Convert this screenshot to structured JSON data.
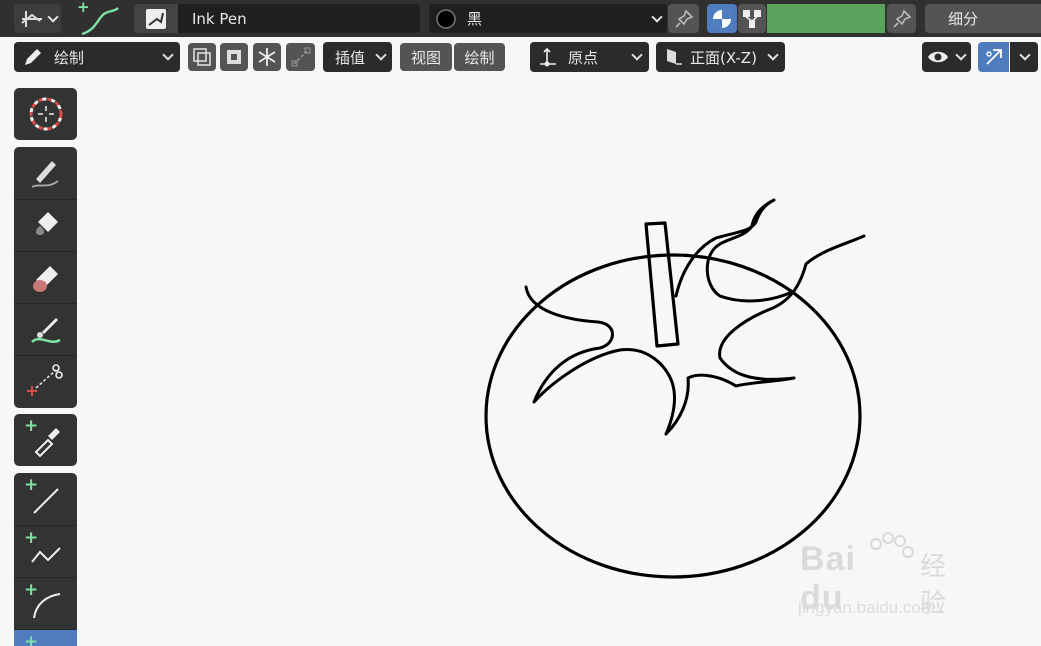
{
  "header": {
    "brush_name": "Ink Pen",
    "material_name": "黑",
    "subdivide_label": "细分",
    "vertex_color_hex": "#5aa35d"
  },
  "toolbar": {
    "mode_label": "绘制",
    "interpolate_label": "插值",
    "view_label": "视图",
    "draw_label": "绘制",
    "origin_label": "原点",
    "axis_label": "正面(X-Z)"
  },
  "tools": [
    {
      "name": "cursor-tool"
    },
    {
      "name": "draw-tool"
    },
    {
      "name": "fill-tool"
    },
    {
      "name": "erase-tool"
    },
    {
      "name": "tint-tool"
    },
    {
      "name": "cutter-tool"
    },
    {
      "name": "eyedropper-tool"
    },
    {
      "name": "line-tool"
    },
    {
      "name": "polyline-tool"
    },
    {
      "name": "arc-tool"
    },
    {
      "name": "curve-tool"
    }
  ],
  "watermark": {
    "logo_text": "Bai du",
    "brand_cn": "经验",
    "url": "jingyan.baidu.com"
  },
  "colors": {
    "accent_blue": "#4f7bbf",
    "plus_green": "#7ee2a5",
    "stroke_black": "#000000"
  }
}
